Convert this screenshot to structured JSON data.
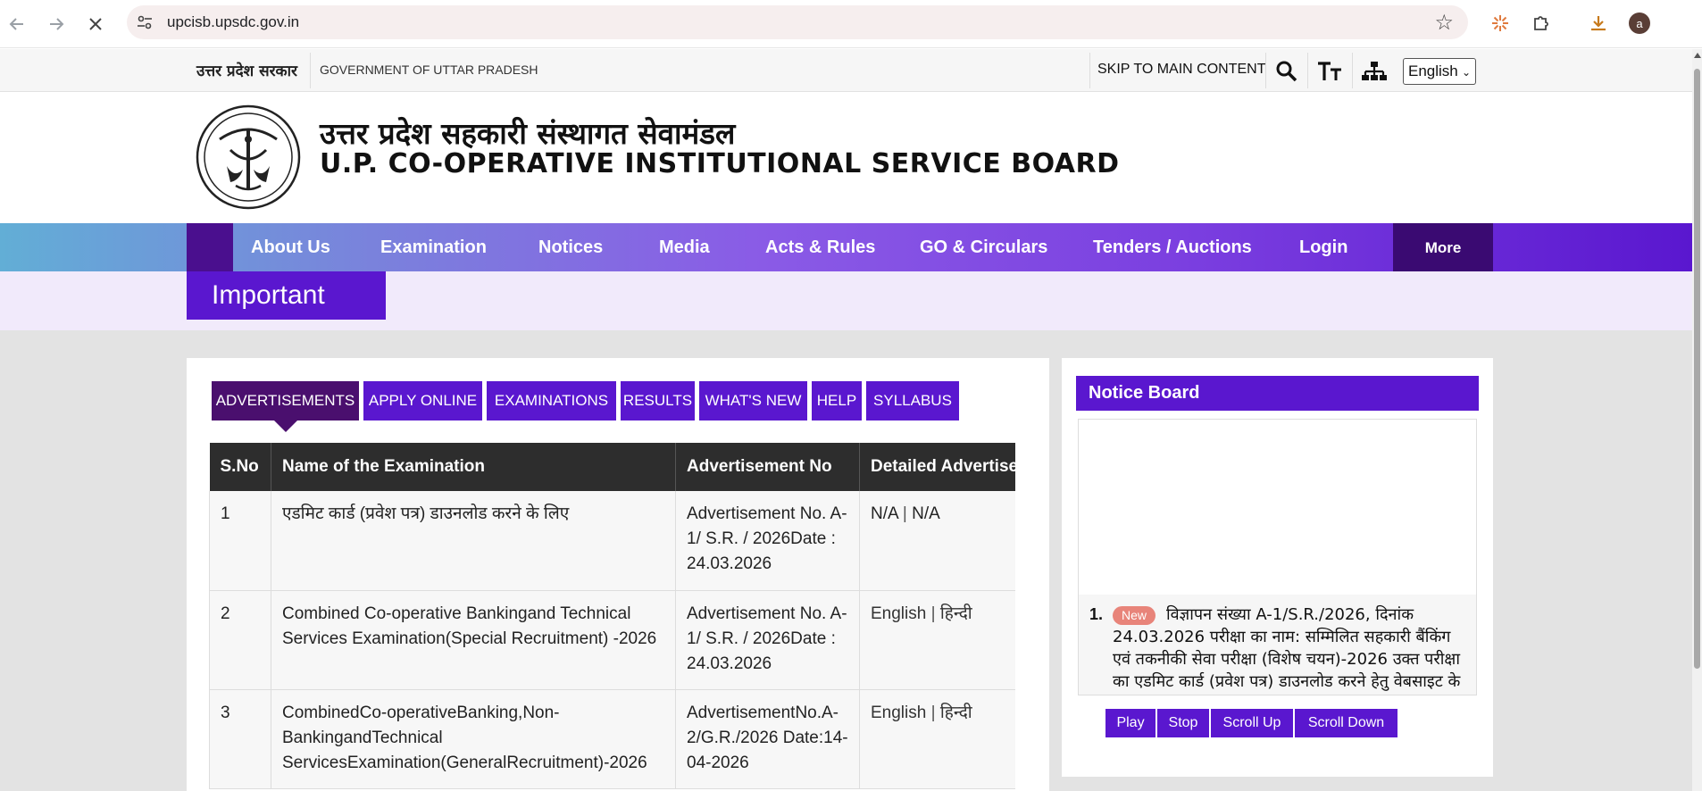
{
  "browser": {
    "url": "upcisb.upsdc.gov.in",
    "avatar_letter": "a",
    "icons": [
      "back-arrow-icon",
      "forward-arrow-icon",
      "stop-loading-icon",
      "site-settings-icon",
      "bookmark-star-icon",
      "extension-sparkle-icon",
      "extensions-puzzle-icon",
      "download-icon"
    ]
  },
  "gov_strip": {
    "hindi": "उत्तर प्रदेश सरकार",
    "english": "GOVERNMENT OF UTTAR PRADESH",
    "skip": "SKIP TO MAIN CONTENT",
    "language": "English"
  },
  "header": {
    "title_hindi": "उत्तर प्रदेश सहकारी संस्थागत सेवामंडल",
    "title_english": "U.P. CO-OPERATIVE INSTITUTIONAL SERVICE BOARD"
  },
  "menu": {
    "home_glyph": "",
    "items": [
      "About Us ",
      "Examination ",
      "Notices  ",
      "Media ",
      "Acts & Rules ",
      "GO & Circulars ",
      "Tenders / Auctions ",
      "Login"
    ],
    "more": "More "
  },
  "important": {
    "label": " Important"
  },
  "tabs": [
    "ADVERTISEMENTS",
    "APPLY ONLINE",
    "EXAMINATIONS",
    "RESULTS",
    "WHAT'S NEW",
    "HELP",
    "SYLLABUS"
  ],
  "table": {
    "headers": [
      "S.No",
      "Name of the Examination",
      "Advertisement No",
      "Detailed Advertisement"
    ],
    "rows": [
      {
        "sno": "1",
        "name": "एडमिट कार्ड (प्रवेश पत्र) डाउनलोड करने के लिए",
        "adv": "Advertisement No. A-1/ S.R. / 2026Date : 24.03.2026",
        "detail_a": "N/A",
        "detail_b": "N/A"
      },
      {
        "sno": "2",
        "name": "Combined Co-operative Bankingand Technical Services Examination(Special Recruitment) -2026",
        "adv": "Advertisement No. A-1/ S.R. / 2026Date : 24.03.2026",
        "detail_a": "English",
        "detail_b": "हिन्दी"
      },
      {
        "sno": "3",
        "name": "CombinedCo-operativeBanking,Non-BankingandTechnical ServicesExamination(GeneralRecruitment)-2026",
        "adv": "AdvertisementNo.A-2/G.R./2026 Date:14-04-2026",
        "detail_a": "English",
        "detail_b": "हिन्दी"
      }
    ]
  },
  "notice_board": {
    "title": " Notice Board",
    "item_num": "1.",
    "badge": "New",
    "item_text": "विज्ञापन संख्या A-1/S.R./2026, दिनांक 24.03.2026 परीक्षा का नाम: सम्मिलित सहकारी बैंकिंग एवं तकनीकी सेवा परीक्षा (विशेष चयन)-2026 उक्त परीक्षा का एडमिट कार्ड (प्रवेश पत्र) डाउनलोड करने हेतु वेबसाइट के",
    "buttons": [
      "Play",
      "Stop",
      "Scroll Up",
      "Scroll Down"
    ]
  }
}
